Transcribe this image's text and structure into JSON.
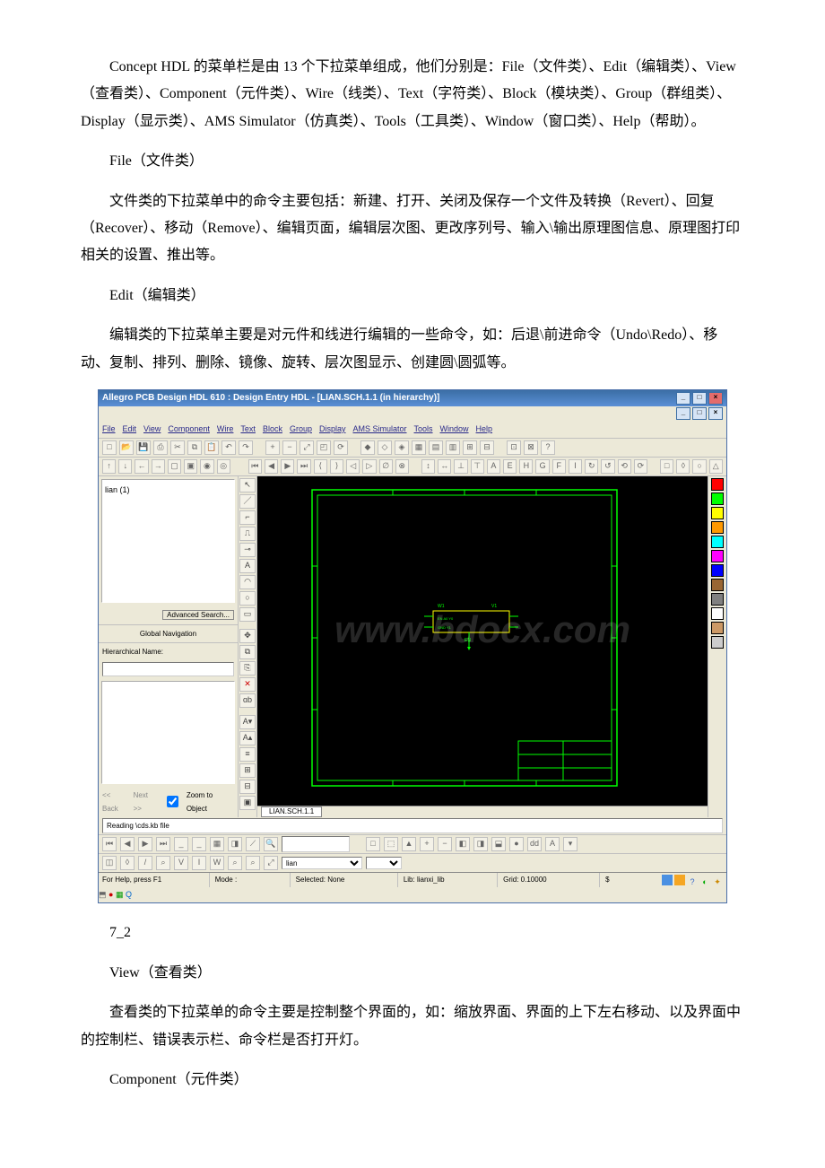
{
  "paragraphs": {
    "p1": "Concept HDL 的菜单栏是由 13 个下拉菜单组成，他们分别是：File（文件类）、Edit（编辑类）、View（查看类）、Component（元件类）、Wire（线类）、Text（字符类）、Block（模块类）、Group（群组类）、Display（显示类）、AMS Simulator（仿真类）、Tools（工具类）、Window（窗口类）、Help（帮助）。",
    "p2": "File（文件类）",
    "p3": "文件类的下拉菜单中的命令主要包括：新建、打开、关闭及保存一个文件及转换（Revert）、回复（Recover）、移动（Remove）、编辑页面，编辑层次图、更改序列号、输入\\输出原理图信息、原理图打印相关的设置、推出等。",
    "p4": "Edit（编辑类）",
    "p5": "编辑类的下拉菜单主要是对元件和线进行编辑的一些命令，如：后退\\前进命令（Undo\\Redo）、移动、复制、排列、删除、镜像、旋转、层次图显示、创建圆\\圆弧等。",
    "caption": "7_2",
    "p6": "View（查看类）",
    "p7": "查看类的下拉菜单的命令主要是控制整个界面的，如：缩放界面、界面的上下左右移动、以及界面中的控制栏、错误表示栏、命令栏是否打开灯。",
    "p8": "Component（元件类）"
  },
  "app": {
    "title": "Allegro PCB Design HDL 610 : Design Entry HDL - [LIAN.SCH.1.1 (in hierarchy)]",
    "menus": [
      "File",
      "Edit",
      "View",
      "Component",
      "Wire",
      "Text",
      "Block",
      "Group",
      "Display",
      "AMS Simulator",
      "Tools",
      "Window",
      "Help"
    ],
    "tree_root": "lian (1)",
    "adv_search": "Advanced Search...",
    "nav_header": "Global Navigation",
    "hier_label": "Hierarchical Name:",
    "nav_back": "<< Back",
    "nav_next": "Next >>",
    "zoom_to_object": "Zoom to Object",
    "canvas_tab": "LIAN.SCH.1.1",
    "log_message": "Reading \\cds.kb file",
    "combo_value": "lian",
    "statusbar": {
      "help": "For Help, press F1",
      "mode": "Mode :",
      "selected": "Selected: None",
      "lib": "Lib: lianxi_lib",
      "grid": "Grid:  0.10000",
      "s": "$"
    },
    "watermark": "www.bdocx.com",
    "palette": [
      "#ff0000",
      "#00ff00",
      "#ffff00",
      "#ff9900",
      "#00ffff",
      "#ff00ff",
      "#0000ff",
      "#996633",
      "#808080",
      "#ffffff",
      "#cc9966",
      "#cccccc"
    ]
  }
}
